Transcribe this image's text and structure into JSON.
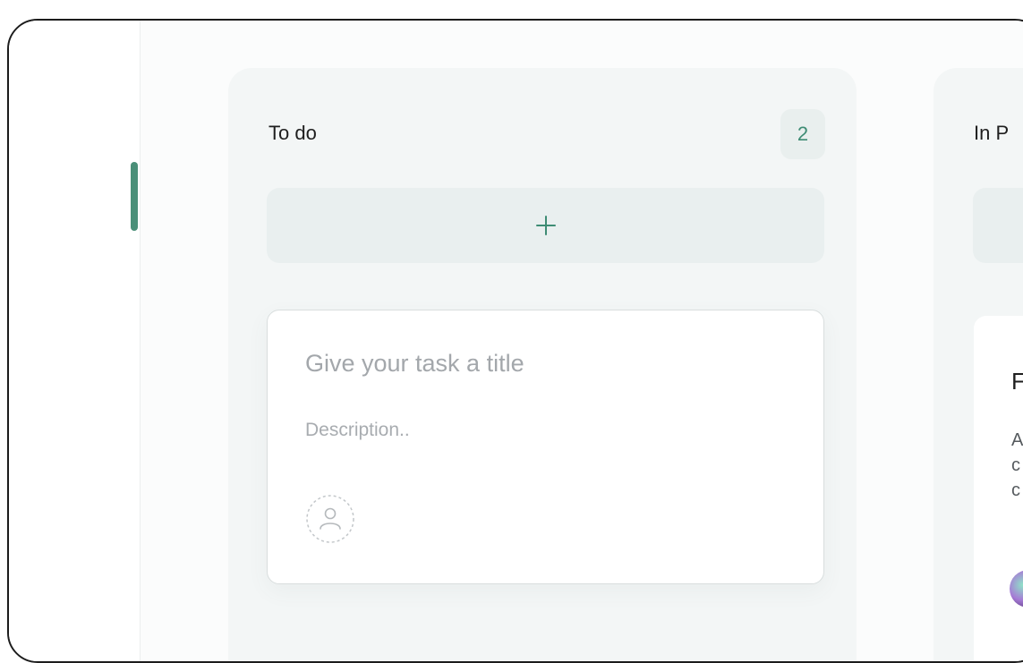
{
  "colors": {
    "accent": "#4a8f78",
    "column_bg": "#f3f6f6",
    "badge_bg": "#e9efee",
    "placeholder": "#a3a7ab"
  },
  "board": {
    "columns": [
      {
        "title": "To do",
        "count": "2",
        "add_icon": "plus-icon",
        "new_task": {
          "title_placeholder": "Give your task a title",
          "description_placeholder": "Description..",
          "assignee_icon": "user-icon"
        }
      },
      {
        "title": "In P",
        "card": {
          "title": "F",
          "description": "A\nc\nc"
        }
      }
    ]
  }
}
